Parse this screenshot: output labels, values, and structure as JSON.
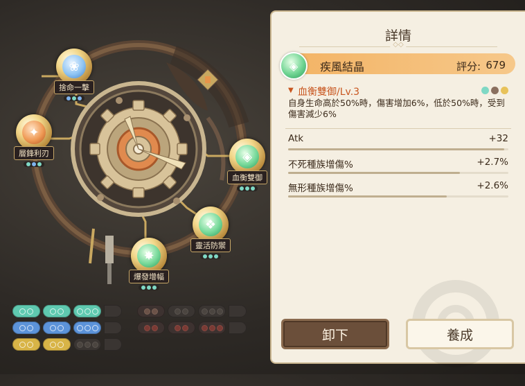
{
  "nodes": [
    {
      "id": "n1",
      "label": "捨命一擊",
      "icon": "wind-icon"
    },
    {
      "id": "n2",
      "label": "層鋒利刃",
      "icon": "blade-icon"
    },
    {
      "id": "n3",
      "label": "血衡雙御",
      "icon": "crystal-icon"
    },
    {
      "id": "n4",
      "label": "靈活防禦",
      "icon": "shield-icon"
    },
    {
      "id": "n5",
      "label": "爆發增幅",
      "icon": "burst-icon"
    }
  ],
  "panel": {
    "title": "詳情",
    "item": {
      "name": "疾風結晶",
      "score_label": "評分:",
      "score": "679",
      "icon": "crystal-icon"
    },
    "skill": {
      "name": "血衡雙御/Lv.3",
      "desc": "自身生命高於50%時，傷害增加6%，低於50%時，受到傷害減少6%",
      "dot_colors": [
        "#7fd8c4",
        "#8a6f5e",
        "#e8c25a"
      ]
    },
    "stats": [
      {
        "label": "Atk",
        "value": "+32",
        "fill": 0.98
      },
      {
        "label": "不死種族增傷%",
        "value": "+2.7%",
        "fill": 0.78
      },
      {
        "label": "無形種族增傷%",
        "value": "+2.6%",
        "fill": 0.72
      }
    ],
    "buttons": {
      "unequip": "卸下",
      "train": "養成"
    }
  },
  "colors": {
    "accent": "#f3b364",
    "skill": "#c8561f",
    "panel_bg": "#f5efe2"
  }
}
